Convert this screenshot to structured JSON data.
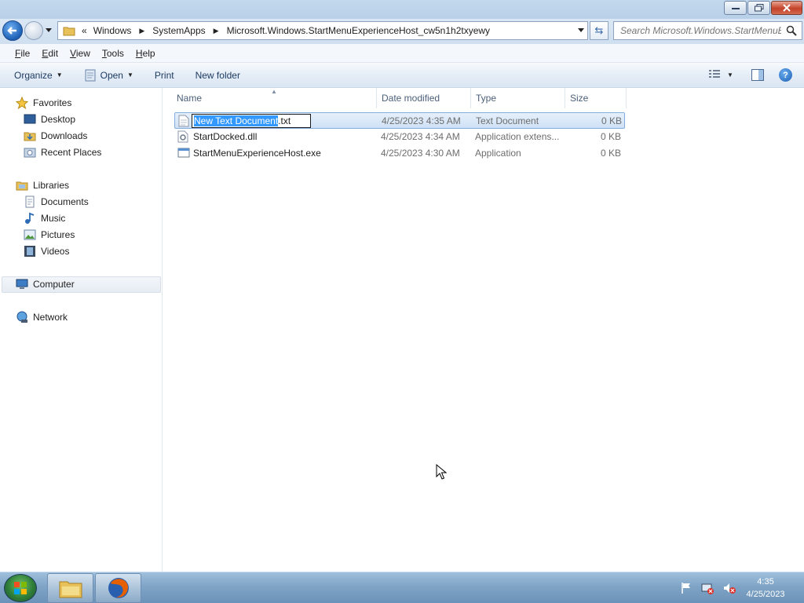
{
  "address": {
    "overflow": "«",
    "crumbs": [
      "Windows",
      "SystemApps",
      "Microsoft.Windows.StartMenuExperienceHost_cw5n1h2txyewy"
    ]
  },
  "search": {
    "placeholder": "Search Microsoft.Windows.StartMenuE..."
  },
  "menu": {
    "items": [
      {
        "label": "File",
        "accel": "F",
        "rest": "ile"
      },
      {
        "label": "Edit",
        "accel": "E",
        "rest": "dit"
      },
      {
        "label": "View",
        "accel": "V",
        "rest": "iew"
      },
      {
        "label": "Tools",
        "accel": "T",
        "rest": "ools"
      },
      {
        "label": "Help",
        "accel": "H",
        "rest": "elp"
      }
    ]
  },
  "toolbar": {
    "organize": "Organize",
    "open": "Open",
    "print": "Print",
    "new_folder": "New folder"
  },
  "nav": {
    "favorites": "Favorites",
    "desktop": "Desktop",
    "downloads": "Downloads",
    "recent": "Recent Places",
    "libraries": "Libraries",
    "documents": "Documents",
    "music": "Music",
    "pictures": "Pictures",
    "videos": "Videos",
    "computer": "Computer",
    "network": "Network"
  },
  "columns": {
    "name": "Name",
    "date": "Date modified",
    "type": "Type",
    "size": "Size"
  },
  "files": [
    {
      "name_selected": "New Text Document",
      "name_ext": ".txt",
      "date": "4/25/2023 4:35 AM",
      "type": "Text Document",
      "size": "0 KB",
      "icon": "text-file-icon"
    },
    {
      "name": "StartDocked.dll",
      "date": "4/25/2023 4:34 AM",
      "type": "Application extens...",
      "size": "0 KB",
      "icon": "dll-file-icon"
    },
    {
      "name": "StartMenuExperienceHost.exe",
      "date": "4/25/2023 4:30 AM",
      "type": "Application",
      "size": "0 KB",
      "icon": "exe-file-icon"
    }
  ],
  "clock": {
    "time": "4:35",
    "date": "4/25/2023"
  },
  "colors": {
    "selection": "#3399ff",
    "row_selected": "#cfe1f6",
    "taskbar": "#7fa4c6"
  }
}
